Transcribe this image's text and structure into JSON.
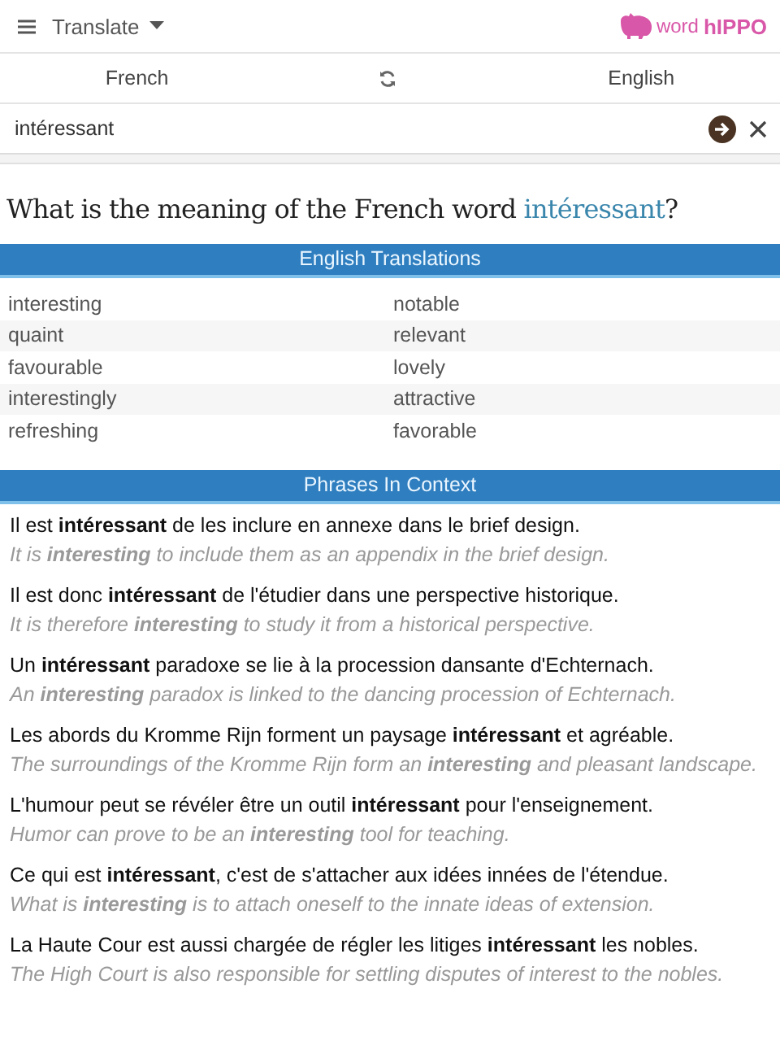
{
  "header": {
    "menu_label": "Translate",
    "logo": {
      "word": "word",
      "brand": "hIPPO"
    }
  },
  "languages": {
    "source": "French",
    "target": "English"
  },
  "search": {
    "value": "intéressant"
  },
  "heading": {
    "before": "What is the meaning of the French word ",
    "word": "intéressant",
    "after": "?"
  },
  "translations": {
    "title": "English Translations",
    "rows": [
      [
        "interesting",
        "notable"
      ],
      [
        "quaint",
        "relevant"
      ],
      [
        "favourable",
        "lovely"
      ],
      [
        "interestingly",
        "attractive"
      ],
      [
        "refreshing",
        "favorable"
      ]
    ]
  },
  "phrases": {
    "title": "Phrases In Context",
    "items": [
      {
        "french": "Il est **intéressant** de les inclure en annexe dans le brief design.",
        "english": "It is **interesting** to include them as an appendix in the brief design."
      },
      {
        "french": "Il est donc **intéressant** de l'étudier dans une perspective historique.",
        "english": "It is therefore **interesting** to study it from a historical perspective."
      },
      {
        "french": "Un **intéressant** paradoxe se lie à la procession dansante d'Echternach.",
        "english": "An **interesting** paradox is linked to the dancing procession of Echternach."
      },
      {
        "french": "Les abords du Kromme Rijn forment un paysage **intéressant** et agréable.",
        "english": "The surroundings of the Kromme Rijn form an **interesting** and pleasant landscape."
      },
      {
        "french": "L'humour peut se révéler être un outil **intéressant** pour l'enseignement.",
        "english": "Humor can prove to be an **interesting** tool for teaching."
      },
      {
        "french": "Ce qui est **intéressant**, c'est de s'attacher aux idées innées de l'étendue.",
        "english": "What is **interesting** is to attach oneself to the innate ideas of extension."
      },
      {
        "french": "La Haute Cour est aussi chargée de régler les litiges **intéressant** les nobles.",
        "english": "The High Court is also responsible for settling disputes of interest to the nobles."
      }
    ]
  }
}
